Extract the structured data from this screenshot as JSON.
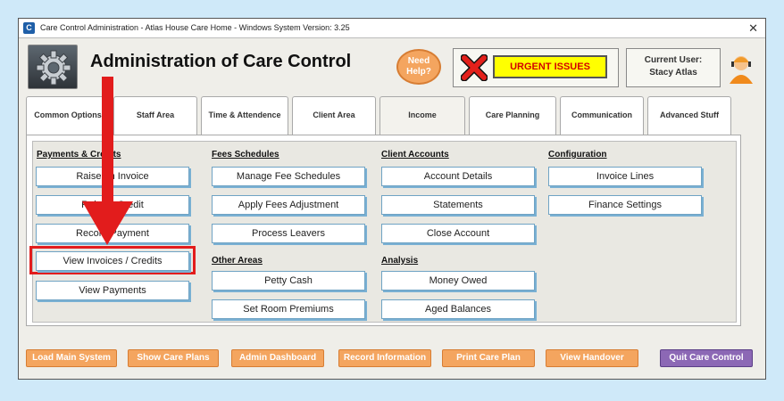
{
  "window": {
    "title": "Care Control Administration - Atlas House Care Home - Windows System Version: 3.25",
    "app_icon_letter": "C",
    "close_glyph": "✕"
  },
  "header": {
    "page_title": "Administration of Care Control",
    "need_help": "Need Help?",
    "urgent_issues": "URGENT ISSUES",
    "current_user_label": "Current User:",
    "current_user_name": "Stacy Atlas"
  },
  "tabs": [
    {
      "label": "Common Options"
    },
    {
      "label": "Staff Area"
    },
    {
      "label": "Time & Attendence"
    },
    {
      "label": "Client Area"
    },
    {
      "label": "Income",
      "active": true
    },
    {
      "label": "Care Planning"
    },
    {
      "label": "Communication"
    },
    {
      "label": "Advanced Stuff"
    }
  ],
  "sections": {
    "payments": {
      "heading": "Payments & Credits",
      "buttons": [
        "Raise an Invoice",
        "Raise a Credit",
        "Record Payment",
        "View Invoices / Credits",
        "View Payments"
      ]
    },
    "fees": {
      "heading": "Fees Schedules",
      "buttons": [
        "Manage Fee Schedules",
        "Apply Fees Adjustment",
        "Process Leavers"
      ]
    },
    "other": {
      "heading": "Other Areas",
      "buttons": [
        "Petty Cash",
        "Set Room Premiums"
      ]
    },
    "client_accounts": {
      "heading": "Client Accounts",
      "buttons": [
        "Account Details",
        "Statements",
        "Close Account"
      ]
    },
    "analysis": {
      "heading": "Analysis",
      "buttons": [
        "Money Owed",
        "Aged Balances"
      ]
    },
    "configuration": {
      "heading": "Configuration",
      "buttons": [
        "Invoice Lines",
        "Finance Settings"
      ]
    }
  },
  "bottom_bar": [
    "Load Main System",
    "Show Care Plans",
    "Admin Dashboard",
    "Record Information",
    "Print Care Plan",
    "View Handover",
    "Quit Care Control"
  ],
  "icons": {
    "app": "app-logo-icon",
    "gear": "gear-icon",
    "urgent": "red-x-icon",
    "user": "user-avatar-icon",
    "annotation": "red-arrow-icon"
  },
  "colors": {
    "accent_orange": "#f4a55f",
    "accent_blue": "#6fa3c4",
    "urgent_yellow": "#ffff00",
    "urgent_red": "#d40000",
    "quit_purple": "#8c68b5",
    "annotation_red": "#e21c1c"
  }
}
